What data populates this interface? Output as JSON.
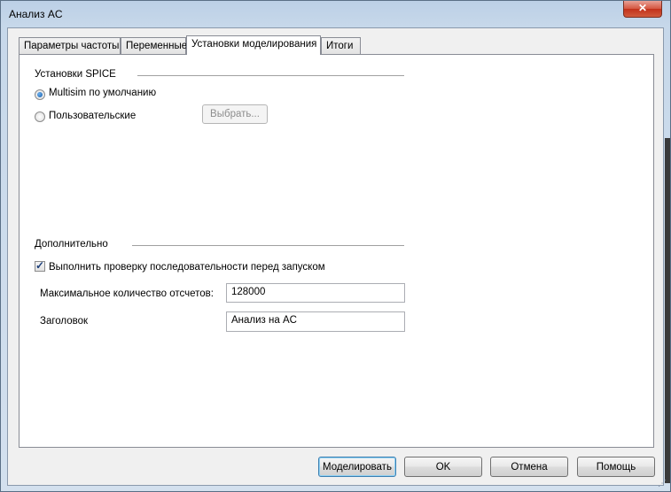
{
  "window": {
    "title": "Анализ AC",
    "close_symbol": "✕"
  },
  "tabs": [
    {
      "label": "Параметры частоты",
      "active": false
    },
    {
      "label": "Переменные",
      "active": false
    },
    {
      "label": "Установки моделирования",
      "active": true
    },
    {
      "label": "Итоги",
      "active": false
    }
  ],
  "spice_group": {
    "label": "Установки SPICE",
    "options": [
      {
        "label": "Multisim по умолчанию",
        "checked": true
      },
      {
        "label": "Пользовательские",
        "checked": false
      }
    ],
    "choose_button": "Выбрать..."
  },
  "additional_group": {
    "label": "Дополнительно",
    "check_sequence": {
      "label": "Выполнить проверку последовательности перед запуском",
      "checked": true
    },
    "max_points": {
      "label": "Максимальное количество отсчетов:",
      "value": "128000"
    },
    "title_field": {
      "label": "Заголовок",
      "value": "Анализ на AC"
    }
  },
  "footer_buttons": {
    "simulate": "Моделировать",
    "ok": "OK",
    "cancel": "Отмена",
    "help": "Помощь"
  },
  "icons": {
    "check_mark": "✓",
    "resize_grip": "⋰"
  }
}
